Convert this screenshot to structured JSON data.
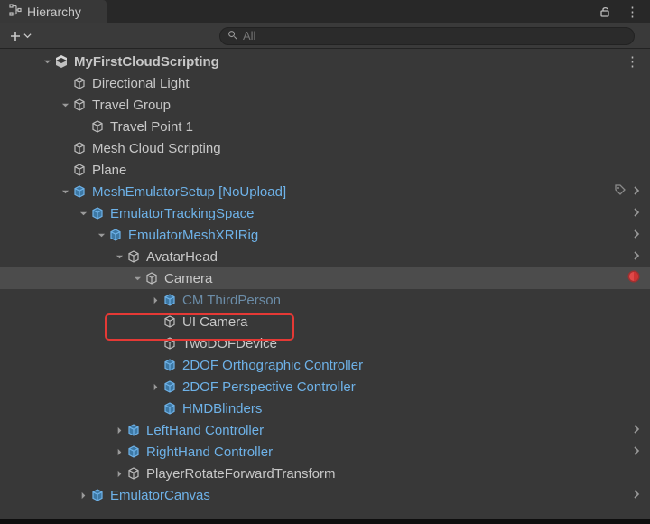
{
  "tab": {
    "title": "Hierarchy"
  },
  "toolbar": {
    "add_icon": "plus",
    "search_placeholder": "All"
  },
  "icons": {
    "lock": "lock-open-icon",
    "kebab": "⋮"
  },
  "colors": {
    "prefab_blue": "#6eb2e8",
    "text": "#c8c8c8",
    "selection_bg": "#4c4c4c",
    "highlight_box": "#e53935"
  },
  "highlight_row_index": 10,
  "tree": [
    {
      "depth": 0,
      "expand": "open",
      "icon": "scene",
      "label": "MyFirstCloudScripting",
      "style": "gray bold",
      "right": [
        "kebab"
      ]
    },
    {
      "depth": 1,
      "expand": "none",
      "icon": "cube-outline",
      "label": "Directional Light",
      "style": "gray"
    },
    {
      "depth": 1,
      "expand": "open",
      "icon": "cube-outline",
      "label": "Travel Group",
      "style": "gray"
    },
    {
      "depth": 2,
      "expand": "none",
      "icon": "cube-outline",
      "label": "Travel Point 1",
      "style": "gray"
    },
    {
      "depth": 1,
      "expand": "none",
      "icon": "cube-outline",
      "label": "Mesh Cloud Scripting",
      "style": "gray"
    },
    {
      "depth": 1,
      "expand": "none",
      "icon": "cube-outline",
      "label": "Plane",
      "style": "gray"
    },
    {
      "depth": 1,
      "expand": "open",
      "icon": "cube-blue",
      "label": "MeshEmulatorSetup [NoUpload]",
      "style": "blue",
      "right": [
        "tag",
        "chev"
      ]
    },
    {
      "depth": 2,
      "expand": "open",
      "icon": "cube-blue",
      "label": "EmulatorTrackingSpace",
      "style": "blue",
      "right": [
        "chev"
      ]
    },
    {
      "depth": 3,
      "expand": "open",
      "icon": "cube-blue",
      "label": "EmulatorMeshXRIRig",
      "style": "blue",
      "right": [
        "chev"
      ]
    },
    {
      "depth": 4,
      "expand": "open",
      "icon": "cube-outline",
      "label": "AvatarHead",
      "style": "gray",
      "right": [
        "chev"
      ]
    },
    {
      "depth": 5,
      "expand": "open",
      "icon": "cube-outline",
      "label": "Camera",
      "style": "gray",
      "selected": true,
      "right": [
        "warn"
      ]
    },
    {
      "depth": 6,
      "expand": "closed",
      "icon": "cube-blue",
      "label": "CM ThirdPerson",
      "style": "dim"
    },
    {
      "depth": 6,
      "expand": "none",
      "icon": "cube-outline",
      "label": "UI Camera",
      "style": "gray"
    },
    {
      "depth": 6,
      "expand": "none",
      "icon": "cube-outline",
      "label": "TwoDOFDevice",
      "style": "gray"
    },
    {
      "depth": 6,
      "expand": "none",
      "icon": "cube-blue",
      "label": "2DOF Orthographic Controller",
      "style": "blue"
    },
    {
      "depth": 6,
      "expand": "closed",
      "icon": "cube-blue",
      "label": "2DOF Perspective Controller",
      "style": "blue"
    },
    {
      "depth": 6,
      "expand": "none",
      "icon": "cube-blue",
      "label": "HMDBlinders",
      "style": "blue"
    },
    {
      "depth": 4,
      "expand": "closed",
      "icon": "cube-blue",
      "label": "LeftHand Controller",
      "style": "blue",
      "right": [
        "chev"
      ]
    },
    {
      "depth": 4,
      "expand": "closed",
      "icon": "cube-blue",
      "label": "RightHand Controller",
      "style": "blue",
      "right": [
        "chev"
      ]
    },
    {
      "depth": 4,
      "expand": "closed",
      "icon": "cube-outline",
      "label": "PlayerRotateForwardTransform",
      "style": "gray"
    },
    {
      "depth": 2,
      "expand": "closed",
      "icon": "cube-blue",
      "label": "EmulatorCanvas",
      "style": "blue",
      "right": [
        "chev"
      ]
    }
  ]
}
